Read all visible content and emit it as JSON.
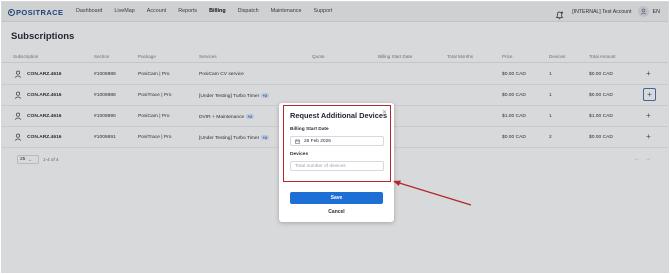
{
  "app": {
    "logo": "POSITRACE",
    "nav": [
      "Dashboard",
      "LiveMap",
      "Account",
      "Reports",
      "Billing",
      "Dispatch",
      "Maintenance",
      "Support"
    ],
    "active_nav": "Billing",
    "account_label": "[INTERNAL] Test Account",
    "language": "EN"
  },
  "page": {
    "title": "Subscriptions"
  },
  "table": {
    "headers": [
      "Subscription",
      "Section",
      "Package",
      "Services",
      "Quote",
      "Billing Start Date",
      "Total Months",
      "Price",
      "Devices",
      "Total Amount"
    ],
    "rows": [
      {
        "subscription": "CON.ARZ.4616",
        "section": "#1009889",
        "package": "PosiCam | Pro",
        "services": "PosiCam CV service",
        "badge": "",
        "price": "$0.00 CAD",
        "devices": "1",
        "total": "$0.00 CAD"
      },
      {
        "subscription": "CON.ARZ.4616",
        "section": "#1009888",
        "package": "PosiTrace | Pro",
        "services": "[Under Testing] Turbo Timer",
        "badge": "+2",
        "price": "$0.00 CAD",
        "devices": "1",
        "total": "$0.00 CAD"
      },
      {
        "subscription": "CON.ARZ.4616",
        "section": "#1009890",
        "package": "PosiCam | Pro",
        "services": "DVIR + Maintenance",
        "badge": "+2",
        "price": "$1.00 CAD",
        "devices": "1",
        "total": "$1.00 CAD"
      },
      {
        "subscription": "CON.ARZ.4616",
        "section": "#1009891",
        "package": "PosiTrace | Pro",
        "services": "[Under Testing] Turbo Timer",
        "badge": "+2",
        "price": "$0.00 CAD",
        "devices": "2",
        "total": "$0.00 CAD"
      }
    ]
  },
  "pagination": {
    "page_size": "25",
    "range": "1-4 of 4"
  },
  "modal": {
    "title": "Request Additional Devices",
    "billing_label": "Billing Start Date",
    "billing_value": "26 Feb 2026",
    "devices_label": "Devices",
    "devices_placeholder": "Total number of devices",
    "save": "Save",
    "cancel": "Cancel"
  },
  "colors": {
    "accent": "#1d6fd6",
    "highlight": "#b2282c",
    "brand": "#1c4a8a"
  }
}
